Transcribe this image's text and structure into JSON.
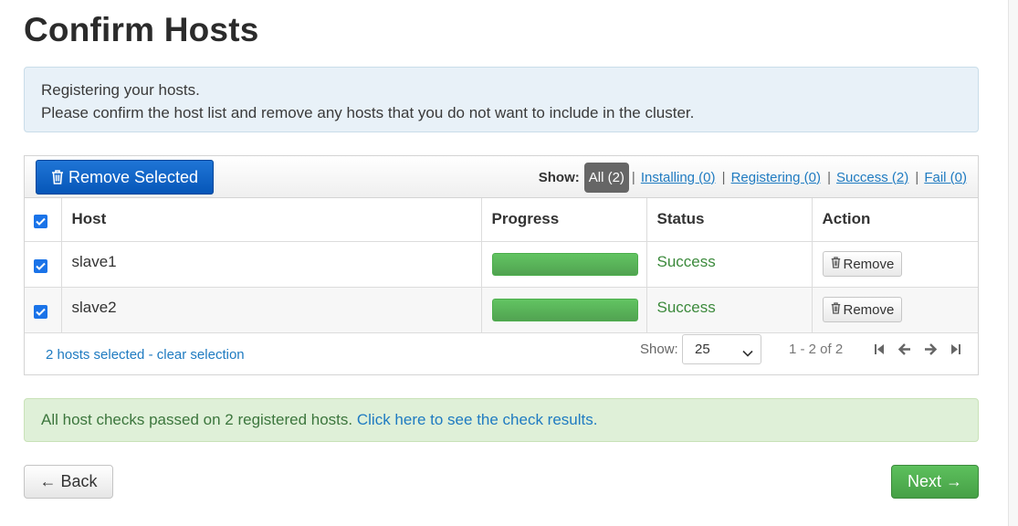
{
  "page": {
    "title": "Confirm Hosts"
  },
  "info": {
    "line1": "Registering your hosts.",
    "line2": "Please confirm the host list and remove any hosts that you do not want to include in the cluster."
  },
  "toolbar": {
    "remove_selected_label": "Remove Selected",
    "show_label": "Show:",
    "filters": [
      {
        "label": "All (2)",
        "active": true
      },
      {
        "label": "Installing (0)",
        "active": false
      },
      {
        "label": "Registering (0)",
        "active": false
      },
      {
        "label": "Success (2)",
        "active": false
      },
      {
        "label": "Fail (0)",
        "active": false
      }
    ]
  },
  "table": {
    "columns": [
      "Host",
      "Progress",
      "Status",
      "Action"
    ],
    "select_all_checked": true,
    "rows": [
      {
        "checked": true,
        "host": "slave1",
        "progress": 1.0,
        "status": "Success",
        "action_label": "Remove"
      },
      {
        "checked": true,
        "host": "slave2",
        "progress": 1.0,
        "status": "Success",
        "action_label": "Remove"
      }
    ]
  },
  "footer": {
    "selection_text": "2 hosts selected",
    "separator": " - ",
    "clear_text": "clear selection",
    "show_label": "Show:",
    "page_size": "25",
    "range_text": "1 - 2 of 2"
  },
  "alert": {
    "text": "All host checks passed on 2 registered hosts. ",
    "link": "Click here to see the check results."
  },
  "nav": {
    "back_label": "← Back",
    "next_label": "Next →"
  },
  "colors": {
    "primary": "#0a5fc4",
    "success": "#5cb85c",
    "link": "#1f7bc1"
  }
}
